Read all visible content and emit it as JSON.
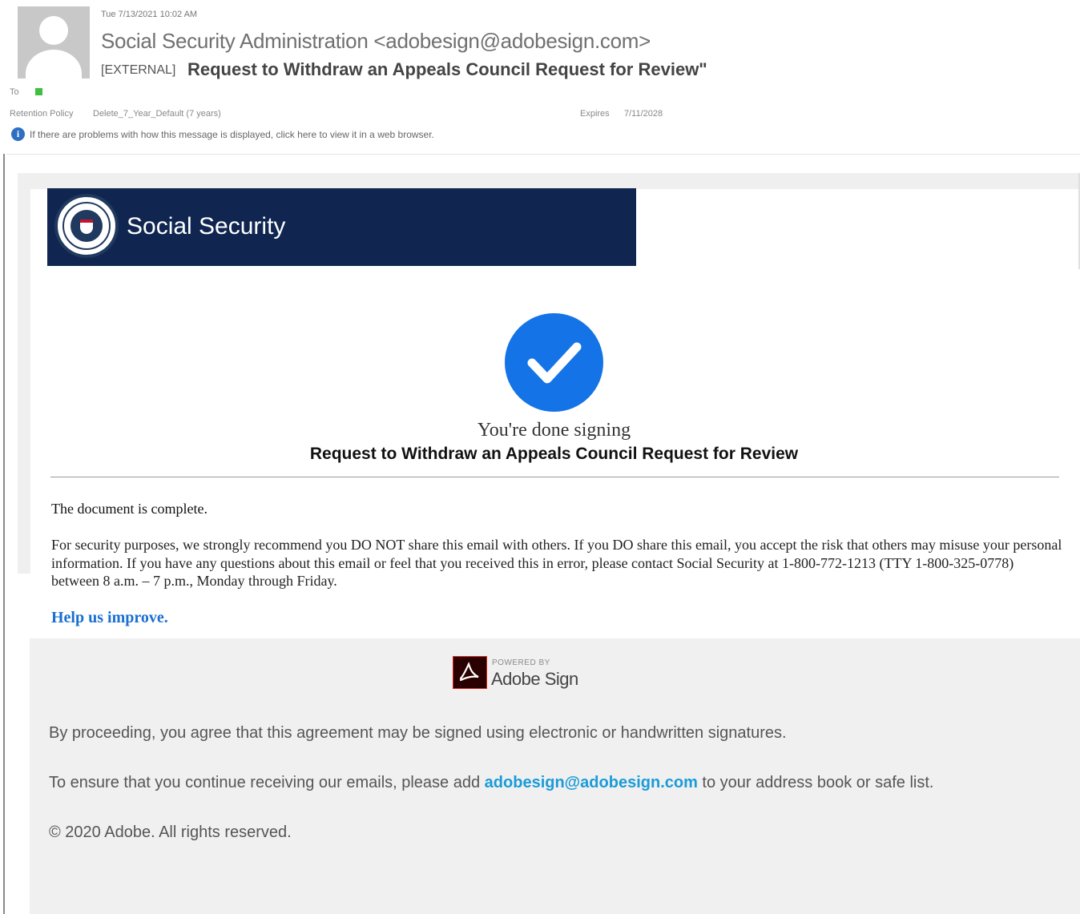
{
  "header": {
    "sent_date": "Tue 7/13/2021 10:02 AM",
    "sender": "Social Security Administration <adobesign@adobesign.com>",
    "subject_tag": "[EXTERNAL]",
    "subject": "Request to Withdraw an Appeals Council Request for Review\"",
    "to_label": "To",
    "retention_label": "Retention Policy",
    "retention_value": "Delete_7_Year_Default (7 years)",
    "expires_label": "Expires",
    "expires_value": "7/11/2028",
    "info_icon_glyph": "i",
    "info_text": "If there are problems with how this message is displayed, click here to view it in a web browser."
  },
  "banner": {
    "title": "Social Security"
  },
  "body": {
    "done_text": "You're  done  signing",
    "document_title": "Request to Withdraw an Appeals Council Request for Review",
    "complete_text": "The document is complete.",
    "security_text": "For security purposes, we strongly recommend you DO NOT share this email with others. If you DO share this email, you accept the risk that others may misuse your personal information.  If you have any questions about this email or feel that you received this in error, please contact Social Security at 1-800-772-1213 (TTY 1-800-325-0778)  between 8 a.m. – 7 p.m., Monday through Friday.",
    "help_link": "Help us improve."
  },
  "footer": {
    "powered_by": "POWERED BY",
    "adobe_sign": "Adobe Sign",
    "agreement_text": "By proceeding, you agree that this agreement may be signed using electronic or handwritten signatures.",
    "safe_list_prefix": "To ensure that you continue receiving our emails, please add ",
    "safe_list_email": "adobesign@adobesign.com",
    "safe_list_suffix": " to your address book or safe list.",
    "copyright": "© 2020 Adobe. All rights reserved."
  },
  "colors": {
    "banner_navy": "#102650",
    "check_blue": "#1473e6",
    "link_blue": "#1a6fd0",
    "email_link": "#1a9bd8",
    "adobe_red": "#d7261e",
    "footer_bg": "#f0f0f0"
  },
  "icons": {
    "avatar": "person-silhouette-icon",
    "presence": "presence-icon",
    "info": "info-icon",
    "seal": "ssa-seal-icon",
    "check": "checkmark-icon",
    "adobe": "adobe-sign-logo-icon"
  }
}
